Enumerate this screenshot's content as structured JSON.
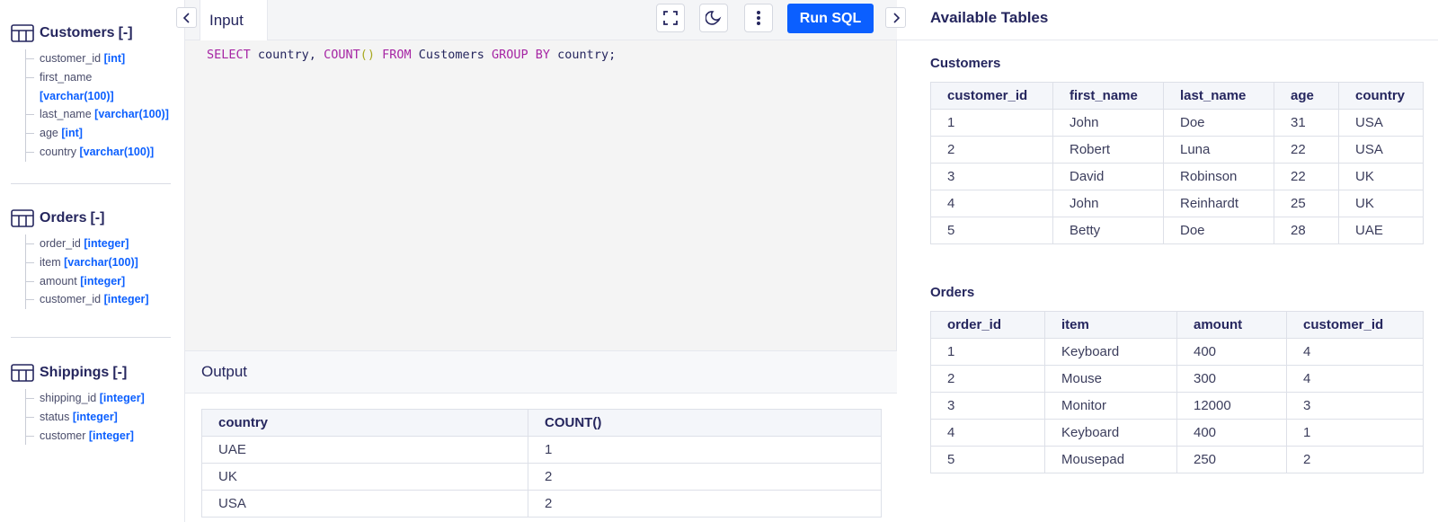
{
  "sidebar": {
    "schemas": [
      {
        "name": "Customers",
        "toggle": "[-]",
        "columns": [
          {
            "name": "customer_id",
            "type": "[int]"
          },
          {
            "name": "first_name",
            "type": "[varchar(100)]"
          },
          {
            "name": "last_name",
            "type": "[varchar(100)]"
          },
          {
            "name": "age",
            "type": "[int]"
          },
          {
            "name": "country",
            "type": "[varchar(100)]"
          }
        ]
      },
      {
        "name": "Orders",
        "toggle": "[-]",
        "columns": [
          {
            "name": "order_id",
            "type": "[integer]"
          },
          {
            "name": "item",
            "type": "[varchar(100)]"
          },
          {
            "name": "amount",
            "type": "[integer]"
          },
          {
            "name": "customer_id",
            "type": "[integer]"
          }
        ]
      },
      {
        "name": "Shippings",
        "toggle": "[-]",
        "columns": [
          {
            "name": "shipping_id",
            "type": "[integer]"
          },
          {
            "name": "status",
            "type": "[integer]"
          },
          {
            "name": "customer",
            "type": "[integer]"
          }
        ]
      }
    ]
  },
  "editor": {
    "tab_label": "Input",
    "run_label": "Run SQL",
    "query": {
      "select": "SELECT",
      "cols": " country, ",
      "count": "COUNT",
      "parens": "()",
      "from": " FROM",
      "table": " Customers ",
      "group_by": "GROUP BY",
      "tail": " country;"
    }
  },
  "output": {
    "title": "Output",
    "headers": [
      "country",
      "COUNT()"
    ],
    "rows": [
      [
        "UAE",
        "1"
      ],
      [
        "UK",
        "2"
      ],
      [
        "USA",
        "2"
      ]
    ]
  },
  "available": {
    "title": "Available Tables",
    "tables": [
      {
        "name": "Customers",
        "headers": [
          "customer_id",
          "first_name",
          "last_name",
          "age",
          "country"
        ],
        "rows": [
          [
            "1",
            "John",
            "Doe",
            "31",
            "USA"
          ],
          [
            "2",
            "Robert",
            "Luna",
            "22",
            "USA"
          ],
          [
            "3",
            "David",
            "Robinson",
            "22",
            "UK"
          ],
          [
            "4",
            "John",
            "Reinhardt",
            "25",
            "UK"
          ],
          [
            "5",
            "Betty",
            "Doe",
            "28",
            "UAE"
          ]
        ]
      },
      {
        "name": "Orders",
        "headers": [
          "order_id",
          "item",
          "amount",
          "customer_id"
        ],
        "rows": [
          [
            "1",
            "Keyboard",
            "400",
            "4"
          ],
          [
            "2",
            "Mouse",
            "300",
            "4"
          ],
          [
            "3",
            "Monitor",
            "12000",
            "3"
          ],
          [
            "4",
            "Keyboard",
            "400",
            "1"
          ],
          [
            "5",
            "Mousepad",
            "250",
            "2"
          ]
        ]
      }
    ]
  },
  "icons": {
    "table": "table-icon",
    "collapse_left": "chevron-left-icon",
    "collapse_right": "chevron-right-icon",
    "fullscreen": "fullscreen-icon",
    "theme": "moon-icon",
    "menu": "more-vertical-icon"
  },
  "colors": {
    "accent": "#0b5fff",
    "text": "#25265e",
    "keyword": "#a626a4"
  }
}
